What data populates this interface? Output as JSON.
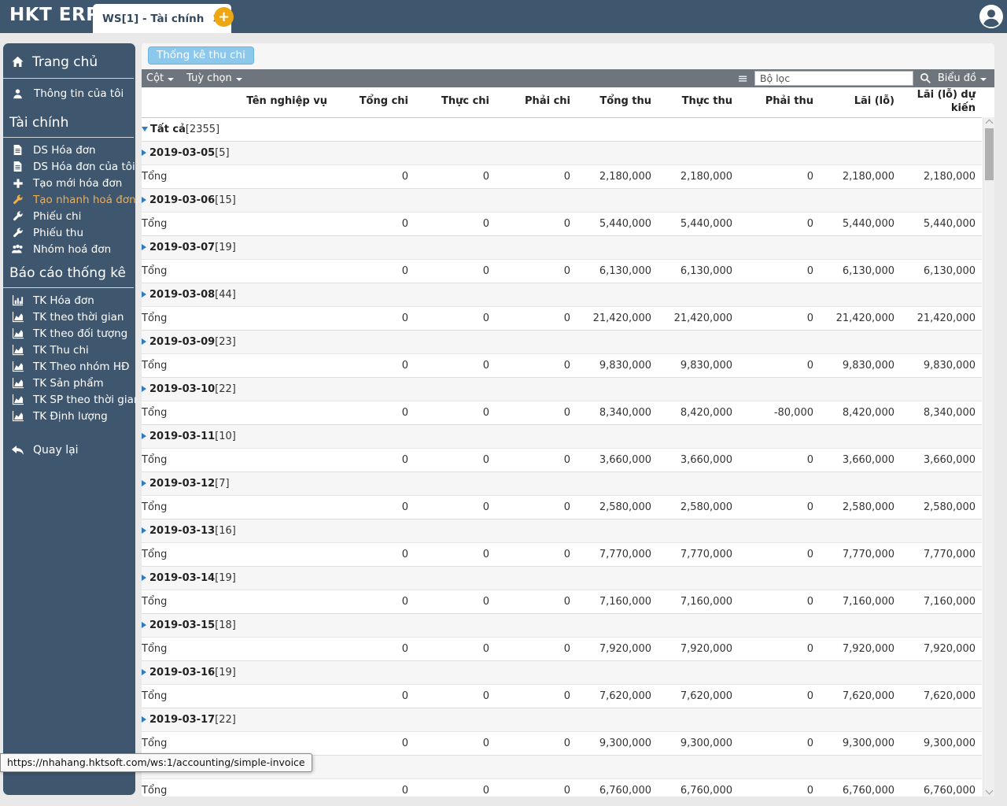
{
  "app": {
    "logo": "HKT ERP",
    "tab": {
      "label": "WS[1] - Tài chính",
      "close_glyph": "×"
    },
    "add_tab_glyph": "+"
  },
  "icons": {
    "home-icon": "house shape",
    "user-icon": "person silhouette",
    "file-icon": "document sheet",
    "plus-icon": "plus cross",
    "wrench-icon": "wrench tool",
    "people-icon": "group of people",
    "bar-chart-icon": "bar chart",
    "area-chart-icon": "area chart",
    "reply-icon": "back curved arrow",
    "user-avatar-icon": "person in circle",
    "menu-icon": "≡",
    "search-icon": "magnifier",
    "close-icon": "×"
  },
  "sidebar": {
    "home": {
      "label": "Trang chủ",
      "icon": "home-icon"
    },
    "profile": {
      "label": "Thông tin của tôi",
      "icon": "user-icon"
    },
    "sections": [
      {
        "title": "Tài chính",
        "items": [
          {
            "label": "DS Hóa đơn",
            "icon": "file-icon",
            "active": false
          },
          {
            "label": "DS Hóa đơn của tôi",
            "icon": "file-icon",
            "active": false
          },
          {
            "label": "Tạo mới hóa đơn",
            "icon": "plus-icon",
            "active": false
          },
          {
            "label": "Tạo nhanh hoá đơn",
            "icon": "wrench-icon",
            "active": true
          },
          {
            "label": "Phiếu chi",
            "icon": "wrench-icon",
            "active": false
          },
          {
            "label": "Phiếu thu",
            "icon": "wrench-icon",
            "active": false
          },
          {
            "label": "Nhóm hoá đơn",
            "icon": "people-icon",
            "active": false
          }
        ]
      },
      {
        "title": "Báo cáo thống kê",
        "items": [
          {
            "label": "TK Hóa đơn",
            "icon": "bar-chart-icon",
            "active": false
          },
          {
            "label": "TK theo thời gian",
            "icon": "area-chart-icon",
            "active": false
          },
          {
            "label": "TK theo đối tượng",
            "icon": "area-chart-icon",
            "active": false
          },
          {
            "label": "TK Thu chi",
            "icon": "area-chart-icon",
            "active": false
          },
          {
            "label": "TK Theo nhóm HĐ",
            "icon": "area-chart-icon",
            "active": false
          },
          {
            "label": "TK Sản phẩm",
            "icon": "area-chart-icon",
            "active": false
          },
          {
            "label": "TK SP theo thời gian",
            "icon": "area-chart-icon",
            "active": false
          },
          {
            "label": "TK Định lượng",
            "icon": "area-chart-icon",
            "active": false
          }
        ]
      }
    ],
    "back": {
      "label": "Quay lại",
      "icon": "reply-icon"
    }
  },
  "main": {
    "view_badge": "Thống kê thu chi",
    "toolbar": {
      "columns_label": "Cột",
      "options_label": "Tuỳ chọn",
      "filter_placeholder": "Bộ lọc",
      "chart_label": "Biểu đồ"
    },
    "table": {
      "columns": [
        "Tên nghiệp vụ",
        "Tổng chi",
        "Thực chi",
        "Phải chi",
        "Tổng thu",
        "Thực thu",
        "Phải thu",
        "Lãi (lỗ)",
        "Lãi (lỗ) dự kiến"
      ],
      "root": {
        "label": "Tất cả",
        "count": "[2355]"
      },
      "total_label": "Tổng",
      "groups": [
        {
          "date": "2019-03-05",
          "count": "[5]",
          "totals": [
            "0",
            "0",
            "0",
            "2,180,000",
            "2,180,000",
            "0",
            "2,180,000",
            "2,180,000"
          ]
        },
        {
          "date": "2019-03-06",
          "count": "[15]",
          "totals": [
            "0",
            "0",
            "0",
            "5,440,000",
            "5,440,000",
            "0",
            "5,440,000",
            "5,440,000"
          ]
        },
        {
          "date": "2019-03-07",
          "count": "[19]",
          "totals": [
            "0",
            "0",
            "0",
            "6,130,000",
            "6,130,000",
            "0",
            "6,130,000",
            "6,130,000"
          ]
        },
        {
          "date": "2019-03-08",
          "count": "[44]",
          "totals": [
            "0",
            "0",
            "0",
            "21,420,000",
            "21,420,000",
            "0",
            "21,420,000",
            "21,420,000"
          ]
        },
        {
          "date": "2019-03-09",
          "count": "[23]",
          "totals": [
            "0",
            "0",
            "0",
            "9,830,000",
            "9,830,000",
            "0",
            "9,830,000",
            "9,830,000"
          ]
        },
        {
          "date": "2019-03-10",
          "count": "[22]",
          "totals": [
            "0",
            "0",
            "0",
            "8,340,000",
            "8,420,000",
            "-80,000",
            "8,420,000",
            "8,340,000"
          ]
        },
        {
          "date": "2019-03-11",
          "count": "[10]",
          "totals": [
            "0",
            "0",
            "0",
            "3,660,000",
            "3,660,000",
            "0",
            "3,660,000",
            "3,660,000"
          ]
        },
        {
          "date": "2019-03-12",
          "count": "[7]",
          "totals": [
            "0",
            "0",
            "0",
            "2,580,000",
            "2,580,000",
            "0",
            "2,580,000",
            "2,580,000"
          ]
        },
        {
          "date": "2019-03-13",
          "count": "[16]",
          "totals": [
            "0",
            "0",
            "0",
            "7,770,000",
            "7,770,000",
            "0",
            "7,770,000",
            "7,770,000"
          ]
        },
        {
          "date": "2019-03-14",
          "count": "[19]",
          "totals": [
            "0",
            "0",
            "0",
            "7,160,000",
            "7,160,000",
            "0",
            "7,160,000",
            "7,160,000"
          ]
        },
        {
          "date": "2019-03-15",
          "count": "[18]",
          "totals": [
            "0",
            "0",
            "0",
            "7,920,000",
            "7,920,000",
            "0",
            "7,920,000",
            "7,920,000"
          ]
        },
        {
          "date": "2019-03-16",
          "count": "[19]",
          "totals": [
            "0",
            "0",
            "0",
            "7,620,000",
            "7,620,000",
            "0",
            "7,620,000",
            "7,620,000"
          ]
        },
        {
          "date": "2019-03-17",
          "count": "[22]",
          "totals": [
            "0",
            "0",
            "0",
            "9,300,000",
            "9,300,000",
            "0",
            "9,300,000",
            "9,300,000"
          ]
        },
        {
          "date": "",
          "count": "",
          "totals": [
            "0",
            "0",
            "0",
            "6,760,000",
            "6,760,000",
            "0",
            "6,760,000",
            "6,760,000"
          ]
        }
      ]
    }
  },
  "status_tooltip": "https://nhahang.hktsoft.com/ws:1/accounting/simple-invoice"
}
